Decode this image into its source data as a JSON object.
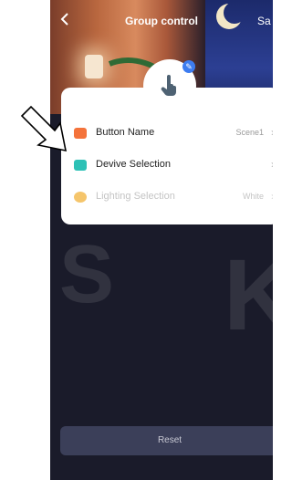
{
  "header": {
    "title": "Group control",
    "save_label": "Sa",
    "back_icon": "chevron-left-icon"
  },
  "card": {
    "rows": [
      {
        "label": "Button Name",
        "value": "Scene1",
        "icon": "button-name-icon",
        "icon_color": "#f4733b"
      },
      {
        "label": "Devive Selection",
        "value": "",
        "icon": "device-selection-icon",
        "icon_color": "#2dc1b6"
      },
      {
        "label": "Lighting Selection",
        "value": "White",
        "icon": "lighting-icon",
        "icon_color": "#f5c56b"
      }
    ],
    "edit_badge": "pencil-icon",
    "main_icon": "tap-hand-icon"
  },
  "footer": {
    "reset_label": "Reset"
  },
  "colors": {
    "background": "#1a1b2a",
    "card": "#ffffff",
    "accent": "#3d7cf0",
    "disabled_text": "#c4c4c4"
  }
}
